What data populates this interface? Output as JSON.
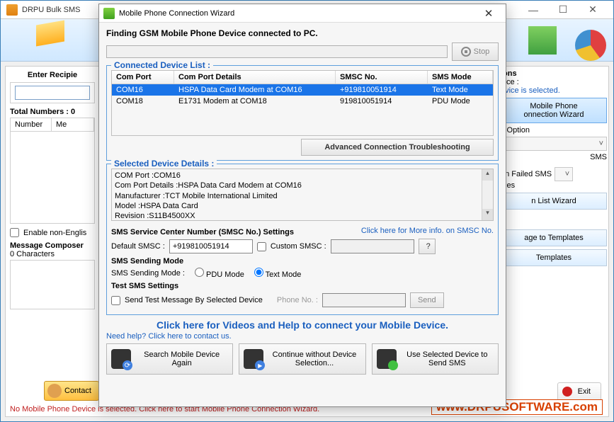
{
  "main": {
    "title": "DRPU Bulk SMS",
    "recipient_label": "Enter Recipie",
    "recipient_value": "",
    "total_label": "Total Numbers : 0",
    "table_cols": [
      "Number",
      "Me"
    ],
    "enable_non_eng": "Enable non-Englis",
    "composer_head": "Message Composer",
    "char_count": "0 Characters",
    "contact_btn": "Contact",
    "exit_btn": "Exit",
    "footer_warn": "No Mobile Phone Device is selected. Click here to start Mobile Phone Connection Wizard.",
    "footer_url": "www.DRPUSOFTWARE.com"
  },
  "right": {
    "options_h": "ions",
    "device_lbl": "vice :",
    "no_dev": "evice is selected.",
    "wiz_btn": "Mobile Phone\nonnection  Wizard",
    "delay_lbl": "y Option",
    "sms_lbl": "SMS",
    "failed_lbl": "on Failed SMS",
    "rules_lbl": "ules",
    "list_wiz": "n List Wizard",
    "save_tmpl": "age to Templates",
    "templates": "Templates"
  },
  "dlg": {
    "title": "Mobile Phone Connection Wizard",
    "finding": "Finding GSM Mobile Phone Device connected to PC.",
    "stop": "Stop",
    "connected_h": "Connected Device List :",
    "cols": {
      "c1": "Com Port",
      "c2": "Com Port Details",
      "c3": "SMSC No.",
      "c4": "SMS Mode"
    },
    "rows": [
      {
        "port": "COM16",
        "details": "HSPA Data Card Modem at COM16",
        "smsc": "+919810051914",
        "mode": "Text Mode",
        "selected": true
      },
      {
        "port": "COM18",
        "details": "E1731 Modem at COM18",
        "smsc": "919810051914",
        "mode": "PDU Mode",
        "selected": false
      }
    ],
    "adv_btn": "Advanced Connection Troubleshooting",
    "selected_h": "Selected Device Details :",
    "details": [
      "COM Port :COM16",
      "Com Port Details :HSPA Data Card Modem at COM16",
      "Manufacturer :TCT Mobile International Limited",
      "Model :HSPA Data Card",
      "Revision :S11B4500XX"
    ],
    "smsc_h": "SMS Service Center Number (SMSC No.) Settings",
    "smsc_more": "Click here for More info. on SMSC No.",
    "def_smsc_lbl": "Default SMSC :",
    "def_smsc_val": "+919810051914",
    "cust_smsc_lbl": "Custom SMSC :",
    "q": "?",
    "mode_h": "SMS Sending Mode",
    "mode_lbl": "SMS Sending Mode :",
    "pdu": "PDU Mode",
    "text": "Text Mode",
    "test_h": "Test SMS Settings",
    "test_chk": "Send Test Message By Selected Device",
    "phone_lbl": "Phone No. :",
    "send": "Send",
    "videos": "Click here for Videos and Help to connect your Mobile Device.",
    "need_help": "Need help? Click here to contact us.",
    "btn_search": "Search Mobile Device Again",
    "btn_continue": "Continue without Device Selection...",
    "btn_use": "Use Selected Device to Send SMS"
  }
}
